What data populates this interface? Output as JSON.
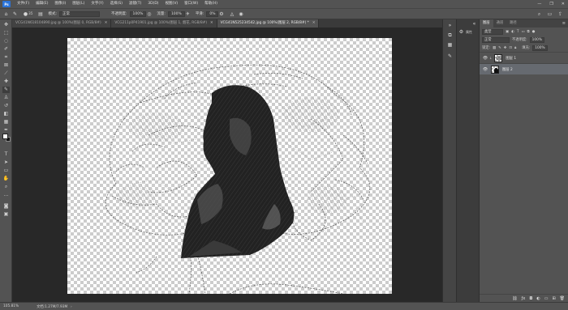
{
  "menubar": {
    "logo": "Ps",
    "items": [
      "文件(F)",
      "编辑(E)",
      "图像(I)",
      "图层(L)",
      "文字(Y)",
      "选择(S)",
      "滤镜(T)",
      "3D(D)",
      "视图(V)",
      "窗口(W)",
      "帮助(H)"
    ],
    "window_controls": [
      "—",
      "❐",
      "✕"
    ]
  },
  "options": {
    "brush_size": "35",
    "mode_label": "模式:",
    "mode_value": "正常",
    "opacity_label": "不透明度:",
    "opacity_value": "100%",
    "flow_label": "流量:",
    "flow_value": "100%",
    "smoothing_label": "平滑:",
    "smoothing_value": "0%"
  },
  "tabs": [
    "VCG41N618104890.jpg @ 100%(图层 0, RGB/8#)",
    "VCG211p0P41901.jpg @ 100%(图层 1, 烟花, RGB/8#)",
    "VCG41N525234542.jpg @ 100%(图层 2, RGB/8#) *"
  ],
  "status": {
    "zoom": "105.81%",
    "doc_info": "文档:1.27M/7.93M"
  },
  "props": {
    "label": "属性"
  },
  "layers_panel": {
    "tabs": [
      "图层",
      "通道",
      "路径"
    ],
    "kind_label": "类型",
    "blend_mode": "正常",
    "opacity_label": "不透明度:",
    "opacity_value": "100%",
    "lock_label": "锁定:",
    "fill_label": "填充:",
    "fill_value": "100%",
    "layers": [
      {
        "name": "图层 1",
        "active": false
      },
      {
        "name": "图层 2",
        "active": true
      }
    ]
  }
}
